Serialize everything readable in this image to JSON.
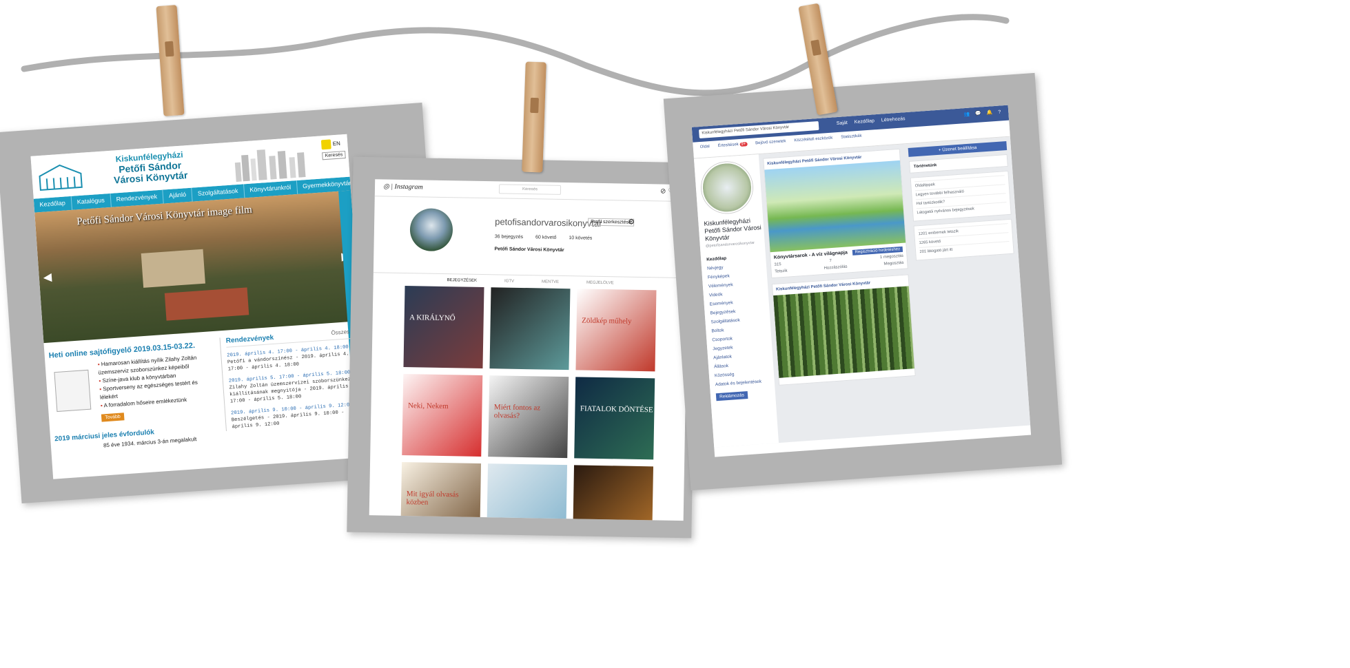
{
  "library": {
    "title1": "Kiskunfélegyházi",
    "title2": "Petőfi Sándor",
    "title3": "Városi Könyvtár",
    "lang": "EN",
    "search_btn": "Keresés",
    "nav": [
      "Kezdőlap",
      "Katalógus",
      "Rendezvények",
      "Ajánló",
      "Szolgáltatások",
      "Könyvtárunkról",
      "Gyermekkönyvtár"
    ],
    "hero_caption": "Petőfi Sándor Városi Könyvtár image film",
    "news_title": "Heti online sajtófigyelő 2019.03.15-03.22.",
    "news_items": [
      "Hamarosan kiállítás nyílik Zilahy Zoltán üzemszerviz szoborszünkez képeiből",
      "Színe-java klub a könyvtárban",
      "Sportverseny az egészséges testért és lélekért",
      "A forradalom hőseire emlékeztünk"
    ],
    "more_btn": "Tovább",
    "ann_title": "2019 márciusi jeles évfordulók",
    "ann_text": "85 éve 1934. március 3-án megalakult",
    "events_title": "Rendezvények",
    "events_all": "Összes →",
    "events": [
      {
        "date": "2019. április 4. 17:00 - április 4. 18:00",
        "text": "Petőfi a vándorszínész - 2019. április 4. 17:00 - április 4. 18:00"
      },
      {
        "date": "2019. április 5. 17:00 - április 5. 18:00",
        "text": "Zilahy Zoltán üzemszervizei szoborszünkezi kiállításának megnyitója - 2019. április 5. 17:00 - április 5. 18:00"
      },
      {
        "date": "2019. április 9. 10:00 - április 9. 12:00",
        "text": "Beszélgetés - 2019. április 9. 10:00 - április 9. 12:00"
      }
    ]
  },
  "instagram": {
    "brand": "Instagram",
    "search": "Keresés",
    "username": "petofisandorvarosikonyvtar",
    "edit_btn": "Profil szerkesztése",
    "stats": [
      "36 bejegyzés",
      "60 követő",
      "10 követés"
    ],
    "display_name": "Petőfi Sándor Városi Könyvtár",
    "tabs": [
      "BEJEGYZÉSEK",
      "IGTV",
      "MENTVE",
      "MEGJELÖLVE"
    ],
    "posts": [
      {
        "text": "A KIRÁLYNŐ",
        "colors": [
          "#2b3c55",
          "#7b3c3c"
        ]
      },
      {
        "text": "",
        "colors": [
          "#222222",
          "#5d9a9a"
        ]
      },
      {
        "text": "Zöldkép műhely",
        "colors": [
          "#ffffff",
          "#c0392b"
        ]
      },
      {
        "text": "Neki, Nekem",
        "colors": [
          "#fdf4f4",
          "#d62f2f"
        ]
      },
      {
        "text": "Miért fontos az olvasás?",
        "colors": [
          "#f4f4f4",
          "#444444"
        ]
      },
      {
        "text": "FIATALOK DÖNTÉSE",
        "colors": [
          "#0f2a44",
          "#2e6d54"
        ]
      },
      {
        "text": "Mit igyál olvasás közben",
        "colors": [
          "#f8f1e3",
          "#6b4b2a"
        ]
      },
      {
        "text": "",
        "colors": [
          "#dfe9ef",
          "#7fb2cc"
        ]
      },
      {
        "text": "",
        "colors": [
          "#2a1a10",
          "#b9762c"
        ]
      }
    ]
  },
  "facebook": {
    "search": "Kiskunfélegyházi Petőfi Sándor Városi Könyvtár",
    "top_links": [
      "Saját",
      "Kezdőlap",
      "Létrehozás"
    ],
    "sub_nav": [
      "Oldal",
      "Értesítések",
      "Bejövő üzenetek",
      "Közzétételi eszközök",
      "Statisztikák"
    ],
    "sub_badge": "9+",
    "page_name": "Kiskunfélegyházi Petőfi Sándor Városi Könyvtár",
    "handle": "@petofisandorvarosikonyvtar",
    "menu": [
      "Kezdőlap",
      "Névjegy",
      "Fényképek",
      "Vélemények",
      "Videók",
      "Események",
      "Bejegyzések",
      "Szolgáltatások",
      "Boltok",
      "Csoportok",
      "Jegyzetek",
      "Ajánlatok",
      "Állások",
      "Közösség",
      "Adatok és bejelentések"
    ],
    "promote": "Reklámozás",
    "post1_author": "Kiskunfélegyházi Petőfi Sándor Városi Könyvtár",
    "post1_title": "Könyvtársarok - A víz világnapja",
    "post1_cta": "Regisztráció hirdetéshez",
    "post1_stats": [
      "315",
      "7",
      "1 megosztás"
    ],
    "post1_actions": [
      "Tetszik",
      "Hozzászólás",
      "Megosztás"
    ],
    "post2_author": "Kiskunfélegyházi Petőfi Sándor Városi Könyvtár",
    "create_btn": "+ Üzenet beállítása",
    "side_title": "Történetünk",
    "side_items": [
      "Oldaltippek",
      "Legyen további felhasználó",
      "Hol tartózkodik?",
      "Látogatói nyilvános bejegyzések"
    ],
    "side_bottom": [
      "1201 embernek tetszik",
      "1265 követő",
      "201 látogató járt itt"
    ]
  }
}
